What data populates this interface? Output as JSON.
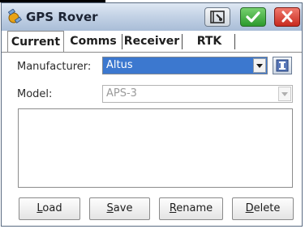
{
  "window": {
    "title": "GPS Rover"
  },
  "titlebar_buttons": {
    "tool_icon": "tool-icon",
    "ok_icon": "checkmark-icon",
    "close_icon": "close-icon"
  },
  "tabs": [
    {
      "label": "Current",
      "active": true
    },
    {
      "label": "Comms",
      "active": false
    },
    {
      "label": "Receiver",
      "active": false
    },
    {
      "label": "RTK",
      "active": false
    }
  ],
  "form": {
    "manufacturer_label": "Manufacturer:",
    "manufacturer_value": "Altus",
    "model_label": "Model:",
    "model_value": "APS-3"
  },
  "buttons": {
    "load": {
      "label": "Load",
      "underline": "L",
      "rest": "oad"
    },
    "save": {
      "label": "Save",
      "underline": "S",
      "rest": "ave"
    },
    "rename": {
      "label": "Rename",
      "underline": "R",
      "rest": "ename"
    },
    "delete": {
      "label": "Delete",
      "underline": "D",
      "rest": "elete"
    }
  },
  "colors": {
    "selection": "#3c78cf",
    "ok": "#2c9a2c",
    "close": "#c82a1e"
  }
}
